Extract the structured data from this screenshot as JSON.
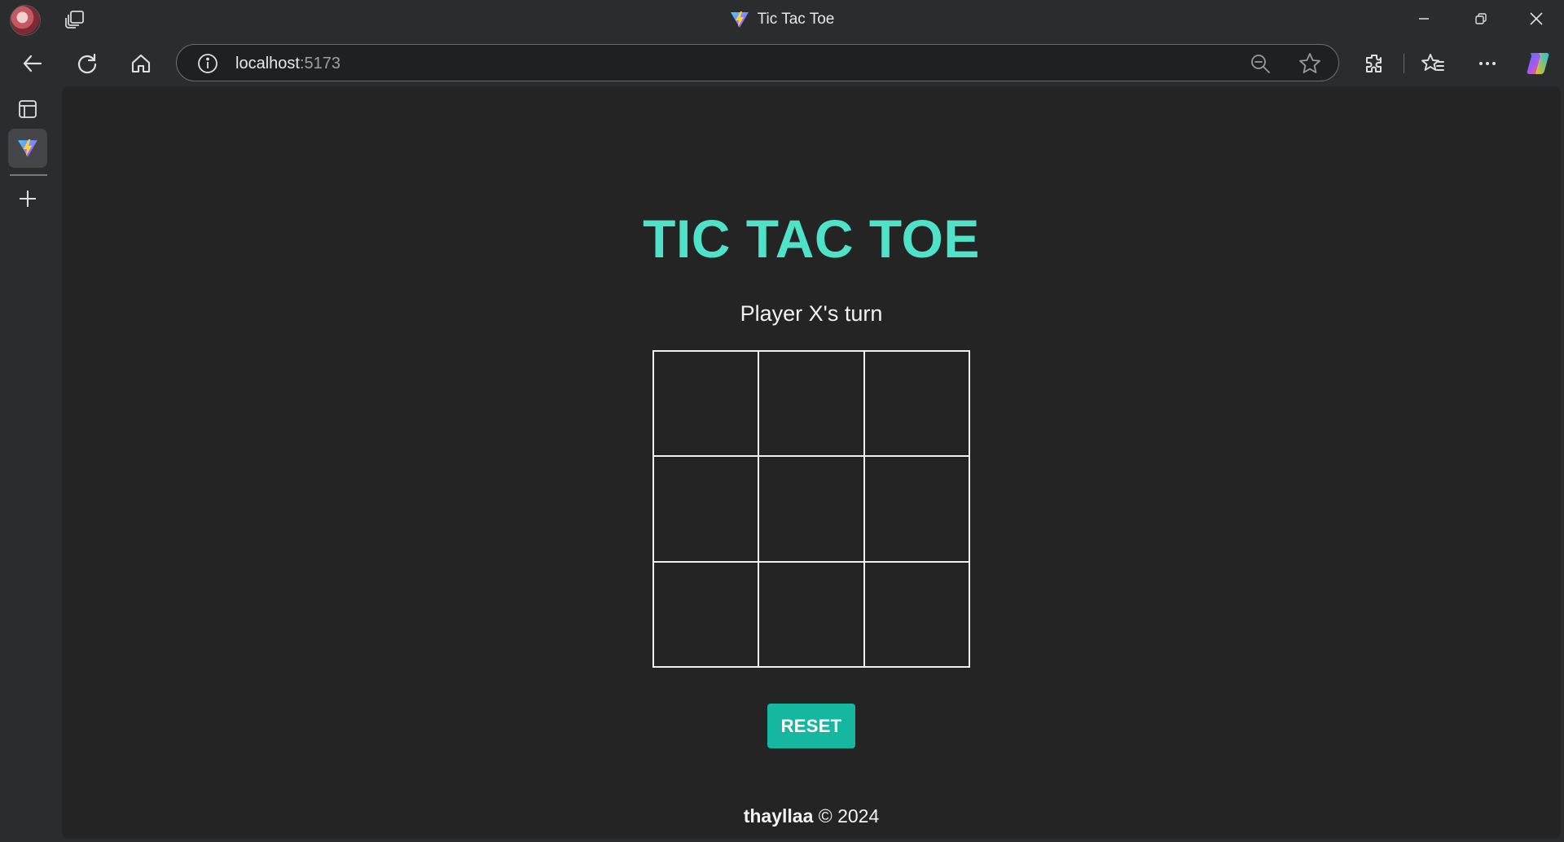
{
  "browser": {
    "window_title": "Tic Tac Toe",
    "url_host": "localhost",
    "url_port": ":5173",
    "accent_copilot": "#6a8cff"
  },
  "game": {
    "title": "TIC TAC TOE",
    "status": "Player X's turn",
    "board": [
      "",
      "",
      "",
      "",
      "",
      "",
      "",
      "",
      ""
    ],
    "reset_label": "RESET",
    "footer_author": "thayllaa",
    "footer_copyright": "© 2024",
    "title_color": "#4ee3c9",
    "button_color": "#15b7a0"
  }
}
